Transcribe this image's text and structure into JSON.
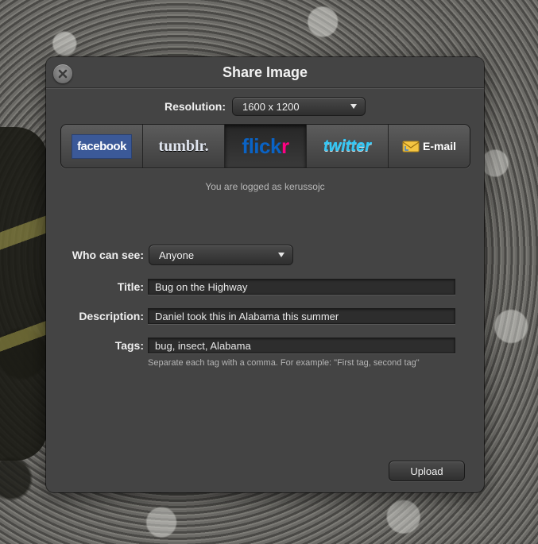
{
  "dialog": {
    "title": "Share Image"
  },
  "resolution": {
    "label": "Resolution:",
    "selected": "1600 x 1200"
  },
  "services": [
    {
      "id": "facebook",
      "label": "facebook"
    },
    {
      "id": "tumblr",
      "label": "tumblr."
    },
    {
      "id": "flickr",
      "label_part1": "flick",
      "label_part2": "r",
      "selected": true
    },
    {
      "id": "twitter",
      "label": "twitter"
    },
    {
      "id": "email",
      "label": "E-mail"
    }
  ],
  "account": {
    "status": "You are logged as kerussojc"
  },
  "form": {
    "who_label": "Who can see:",
    "who_value": "Anyone",
    "title_label": "Title:",
    "title_value": "Bug on the Highway",
    "description_label": "Description:",
    "description_value": "Daniel took this in Alabama this summer",
    "tags_label": "Tags:",
    "tags_value": "bug, insect, Alabama",
    "tags_hint": "Separate each tag with a comma. For example: \"First tag, second tag\""
  },
  "actions": {
    "upload_label": "Upload"
  },
  "colors": {
    "facebook": "#3b5998",
    "flickr_blue": "#0a63c5",
    "flickr_pink": "#ff0084",
    "twitter": "#34c7f4"
  }
}
